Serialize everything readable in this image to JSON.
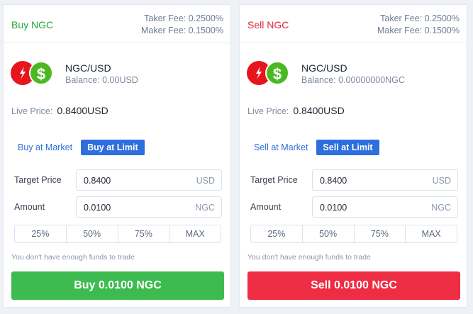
{
  "colors": {
    "buy": "#3dbb50",
    "sell": "#ee2c44",
    "accent": "#2e6fdd",
    "coin_red": "#e8141d",
    "coin_green": "#4cb821"
  },
  "buy": {
    "title": "Buy NGC",
    "taker_fee": "Taker Fee: 0.2500%",
    "maker_fee": "Maker Fee: 0.1500%",
    "coin_icon": "ngc-coin-icon",
    "usd_icon": "usd-coin-icon",
    "usd_symbol": "$",
    "pair": "NGC/USD",
    "balance": "Balance: 0.00USD",
    "live_label": "Live Price:",
    "live_value": "0.8400USD",
    "tab_market": "Buy at Market",
    "tab_limit": "Buy at Limit",
    "target_label": "Target Price",
    "target_value": "0.8400",
    "target_unit": "USD",
    "amount_label": "Amount",
    "amount_value": "0.0100",
    "amount_unit": "NGC",
    "percents": [
      "25%",
      "50%",
      "75%",
      "MAX"
    ],
    "warning": "You don't have enough funds to trade",
    "submit": "Buy 0.0100 NGC"
  },
  "sell": {
    "title": "Sell NGC",
    "taker_fee": "Taker Fee: 0.2500%",
    "maker_fee": "Maker Fee: 0.1500%",
    "coin_icon": "ngc-coin-icon",
    "usd_icon": "usd-coin-icon",
    "usd_symbol": "$",
    "pair": "NGC/USD",
    "balance": "Balance: 0.00000000NGC",
    "live_label": "Live Price:",
    "live_value": "0.8400USD",
    "tab_market": "Sell at Market",
    "tab_limit": "Sell at Limit",
    "target_label": "Target Price",
    "target_value": "0.8400",
    "target_unit": "USD",
    "amount_label": "Amount",
    "amount_value": "0.0100",
    "amount_unit": "NGC",
    "percents": [
      "25%",
      "50%",
      "75%",
      "MAX"
    ],
    "warning": "You don't have enough funds to trade",
    "submit": "Sell 0.0100 NGC"
  }
}
